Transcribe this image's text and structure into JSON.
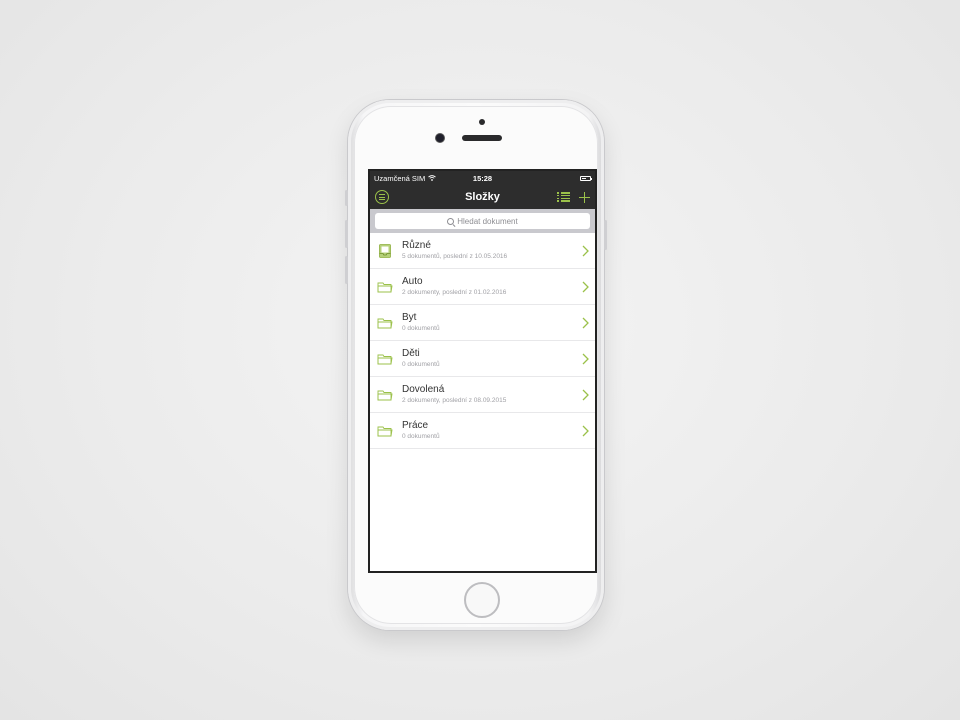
{
  "statusbar": {
    "carrier": "Uzamčená SIM",
    "time": "15:28",
    "icons": [
      "wifi-icon",
      "battery-icon"
    ]
  },
  "navbar": {
    "title": "Složky",
    "accent_color": "#9bc14a",
    "left_icon": "menu-icon",
    "right_icons": [
      "list-view-icon",
      "plus-icon"
    ]
  },
  "search": {
    "placeholder": "Hledat dokument"
  },
  "folders": [
    {
      "name": "Různé",
      "detail": "5 dokumentů, poslední z 10.05.2016",
      "icon": "inbox-icon"
    },
    {
      "name": "Auto",
      "detail": "2 dokumenty, poslední z 01.02.2016",
      "icon": "folder-icon"
    },
    {
      "name": "Byt",
      "detail": "0 dokumentů",
      "icon": "folder-icon"
    },
    {
      "name": "Děti",
      "detail": "0 dokumentů",
      "icon": "folder-icon"
    },
    {
      "name": "Dovolená",
      "detail": "2 dokumenty, poslední z 08.09.2015",
      "icon": "folder-icon"
    },
    {
      "name": "Práce",
      "detail": "0 dokumentů",
      "icon": "folder-icon"
    }
  ]
}
